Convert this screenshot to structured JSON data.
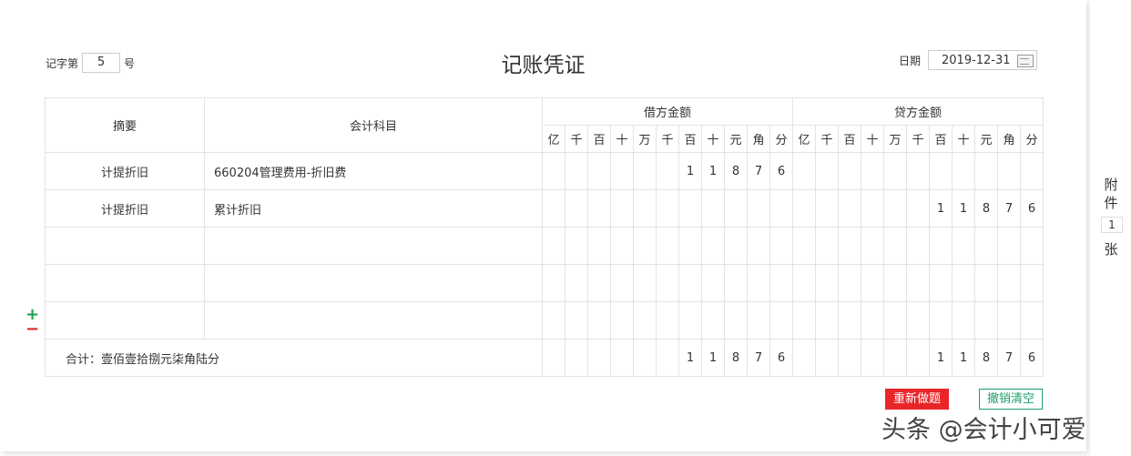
{
  "header": {
    "voucher_prefix": "记字第",
    "voucher_no": "5",
    "voucher_suffix": "号",
    "title": "记账凭证",
    "date_label": "日期",
    "date": "2019-12-31"
  },
  "table": {
    "col_summary": "摘要",
    "col_account": "会计科目",
    "col_debit": "借方金额",
    "col_credit": "贷方金额",
    "digit_units": [
      "亿",
      "千",
      "百",
      "十",
      "万",
      "千",
      "百",
      "十",
      "元",
      "角",
      "分"
    ],
    "rows": [
      {
        "summary": "计提折旧",
        "account": "660204管理费用-折旧费",
        "debit": "11876",
        "credit": ""
      },
      {
        "summary": "计提折旧",
        "account": "累计折旧",
        "debit": "",
        "credit": "11876"
      },
      {
        "summary": "",
        "account": "",
        "debit": "",
        "credit": ""
      },
      {
        "summary": "",
        "account": "",
        "debit": "",
        "credit": ""
      },
      {
        "summary": "",
        "account": "",
        "debit": "",
        "credit": ""
      }
    ],
    "total": {
      "label": "合计：壹佰壹拾捌元柒角陆分",
      "debit": "11876",
      "credit": "11876"
    }
  },
  "controls": {
    "add": "+",
    "remove": "−",
    "redo": "重新做题",
    "clear": "撤销清空"
  },
  "attachment": {
    "label1": "附",
    "label2": "件",
    "count": "1",
    "label3": "张"
  },
  "watermark": "头条 @会计小可爱"
}
